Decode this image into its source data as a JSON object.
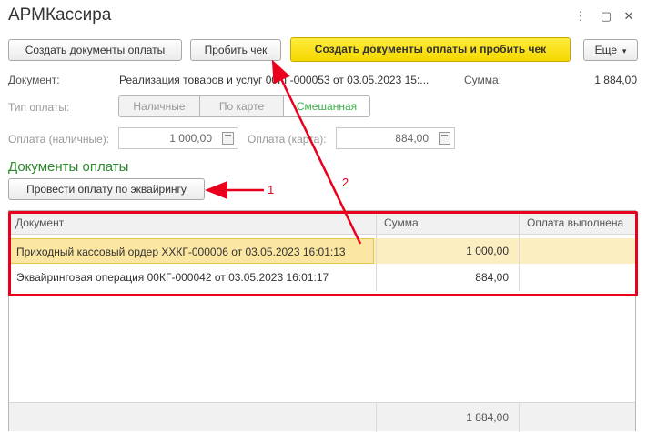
{
  "window": {
    "title": "АРМКассира"
  },
  "toolbar": {
    "create_docs": "Создать документы оплаты",
    "print_check": "Пробить чек",
    "create_and_print": "Создать документы оплаты и пробить чек",
    "more": "Еще"
  },
  "document": {
    "label": "Документ:",
    "value": "Реализация товаров и услуг 00КГ-000053 от 03.05.2023 15:...",
    "sum_label": "Сумма:",
    "sum_value": "1 884,00"
  },
  "payment_type": {
    "label": "Тип оплаты:",
    "options": [
      "Наличные",
      "По карте",
      "Смешанная"
    ],
    "selected": "Смешанная"
  },
  "payment_cash": {
    "label": "Оплата (наличные):",
    "value": "1 000,00"
  },
  "payment_card": {
    "label": "Оплата (карта):",
    "value": "884,00"
  },
  "section_title": "Документы оплаты",
  "acquiring_button": "Провести оплату по эквайрингу",
  "table": {
    "columns": [
      "Документ",
      "Сумма",
      "Оплата выполнена"
    ],
    "rows": [
      {
        "doc": "Приходный кассовый ордер ХХКГ-000006 от 03.05.2023 16:01:13",
        "sum": "1 000,00",
        "done": ""
      },
      {
        "doc": "Эквайринговая операция 00КГ-000042 от 03.05.2023 16:01:17",
        "sum": "884,00",
        "done": ""
      }
    ],
    "total_sum": "1 884,00"
  },
  "annotations": {
    "marker1": "1",
    "marker2": "2",
    "color": "#e8001c"
  },
  "colors": {
    "accent_yellow": "#f5d800",
    "section_green": "#2d8a2d",
    "selected_row": "#fbeec0"
  }
}
